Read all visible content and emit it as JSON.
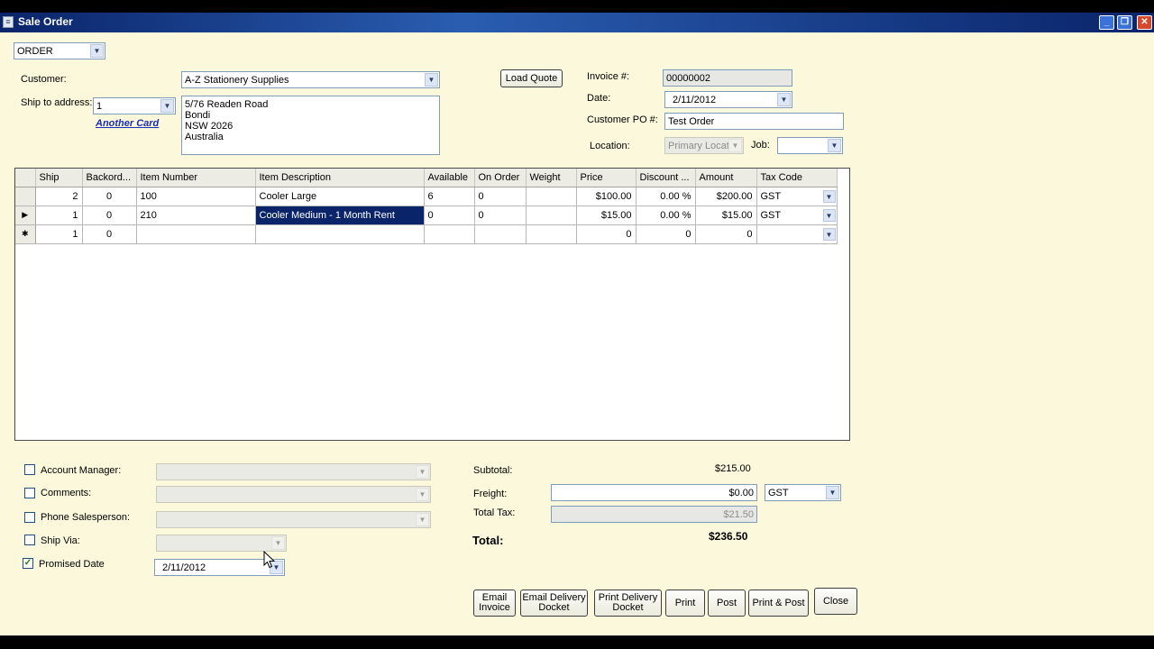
{
  "window": {
    "title": "Sale Order"
  },
  "order_type": "ORDER",
  "customer": {
    "label": "Customer:",
    "value": "A-Z Stationery Supplies"
  },
  "ship_to": {
    "label": "Ship to address:",
    "value": "1",
    "another_card": "Another Card",
    "address_lines": [
      "5/76 Readen Road",
      "Bondi",
      "NSW  2026",
      "Australia"
    ]
  },
  "load_quote": "Load Quote",
  "invoice": {
    "label": "Invoice #:",
    "value": "00000002"
  },
  "date": {
    "label": "Date:",
    "value": "2/11/2012"
  },
  "customer_po": {
    "label": "Customer PO #:",
    "value": "Test Order"
  },
  "location": {
    "label": "Location:",
    "value": "Primary Locati"
  },
  "job": {
    "label": "Job:",
    "value": ""
  },
  "grid": {
    "columns": [
      "Ship",
      "Backord...",
      "Item Number",
      "Item Description",
      "Available",
      "On Order",
      "Weight",
      "Price",
      "Discount ...",
      "Amount",
      "Tax Code"
    ],
    "rows": [
      {
        "indicator": "",
        "ship": "2",
        "backorder": "0",
        "item_number": "100",
        "description": "Cooler Large",
        "available": "6",
        "on_order": "0",
        "weight": "",
        "price": "$100.00",
        "discount": "0.00 %",
        "amount": "$200.00",
        "tax_code": "GST"
      },
      {
        "indicator": "▶",
        "ship": "1",
        "backorder": "0",
        "item_number": "210",
        "description": "Cooler Medium - 1 Month Rent",
        "available": "0",
        "on_order": "0",
        "weight": "",
        "price": "$15.00",
        "discount": "0.00 %",
        "amount": "$15.00",
        "tax_code": "GST"
      },
      {
        "indicator": "✱",
        "ship": "1",
        "backorder": "0",
        "item_number": "",
        "description": "",
        "available": "",
        "on_order": "",
        "weight": "",
        "price": "0",
        "discount": "0",
        "amount": "0",
        "tax_code": ""
      }
    ]
  },
  "options": {
    "account_manager": "Account Manager:",
    "comments": "Comments:",
    "phone_salesperson": "Phone Salesperson:",
    "ship_via": "Ship Via:",
    "promised_date": "Promised Date",
    "promised_date_value": "2/11/2012",
    "promised_checked": "✓"
  },
  "totals": {
    "subtotal_label": "Subtotal:",
    "subtotal": "$215.00",
    "freight_label": "Freight:",
    "freight": "$0.00",
    "freight_tax": "GST",
    "total_tax_label": "Total Tax:",
    "total_tax": "$21.50",
    "total_label": "Total:",
    "total": "$236.50"
  },
  "buttons": {
    "email_invoice": [
      "Email",
      "Invoice"
    ],
    "email_delivery": [
      "Email Delivery",
      "Docket"
    ],
    "print_delivery": [
      "Print Delivery",
      "Docket"
    ],
    "print": "Print",
    "post": "Post",
    "print_post": "Print & Post",
    "close": "Close"
  },
  "icons": {
    "dropdown": "▼",
    "minimize": "_",
    "restore": "❐",
    "close": "✕",
    "app": "≡"
  }
}
